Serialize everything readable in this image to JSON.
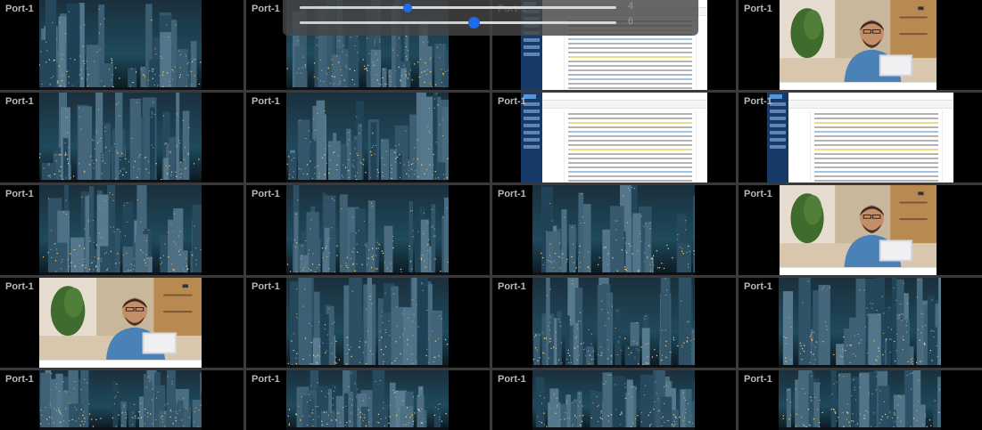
{
  "grid": {
    "port_label": "Port-1",
    "cells": [
      {
        "content": "city"
      },
      {
        "content": "city"
      },
      {
        "content": "document"
      },
      {
        "content": "portrait"
      },
      {
        "content": "city"
      },
      {
        "content": "city"
      },
      {
        "content": "document"
      },
      {
        "content": "document"
      },
      {
        "content": "city"
      },
      {
        "content": "city"
      },
      {
        "content": "city"
      },
      {
        "content": "portrait"
      },
      {
        "content": "portrait"
      },
      {
        "content": "city"
      },
      {
        "content": "city"
      },
      {
        "content": "city"
      },
      {
        "content": "city"
      },
      {
        "content": "city"
      },
      {
        "content": "city"
      },
      {
        "content": "city"
      }
    ]
  },
  "overlay": {
    "sliders": [
      {
        "name": "slider-1",
        "value": "4",
        "level": 0.34
      },
      {
        "name": "slider-2",
        "value": "6",
        "level": 0.55
      }
    ]
  },
  "portrait_caption": {
    "left": "…",
    "center": "…",
    "right": ""
  },
  "colors": {
    "accent": "#1e6bf0",
    "grid_line": "#3a3a3a",
    "doc_sidebar": "#173b66"
  }
}
